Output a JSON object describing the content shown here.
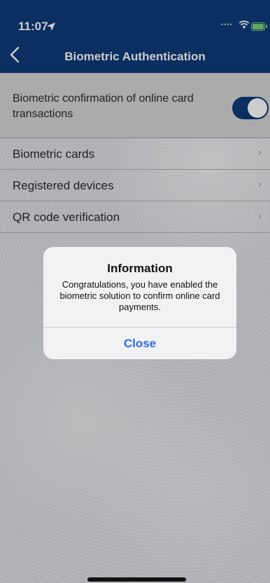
{
  "status_bar": {
    "time": "11:07",
    "location_icon": "location-arrow-icon",
    "wifi_icon": "wifi-icon",
    "battery_icon": "battery-charging-icon",
    "battery_color": "#79d37a"
  },
  "nav": {
    "title": "Biometric Authentication",
    "back_icon": "chevron-left-icon",
    "background": "#0d3b78"
  },
  "setting": {
    "label": "Biometric confirmation of online card transactions",
    "toggle_on": true
  },
  "menu_items": [
    {
      "label": "Biometric cards"
    },
    {
      "label": "Registered devices"
    },
    {
      "label": "QR code verification"
    }
  ],
  "dialog": {
    "title": "Information",
    "message": "Congratulations, you have enabled the biometric solution to confirm online card payments.",
    "close_label": "Close",
    "button_color": "#2a6fe0"
  }
}
